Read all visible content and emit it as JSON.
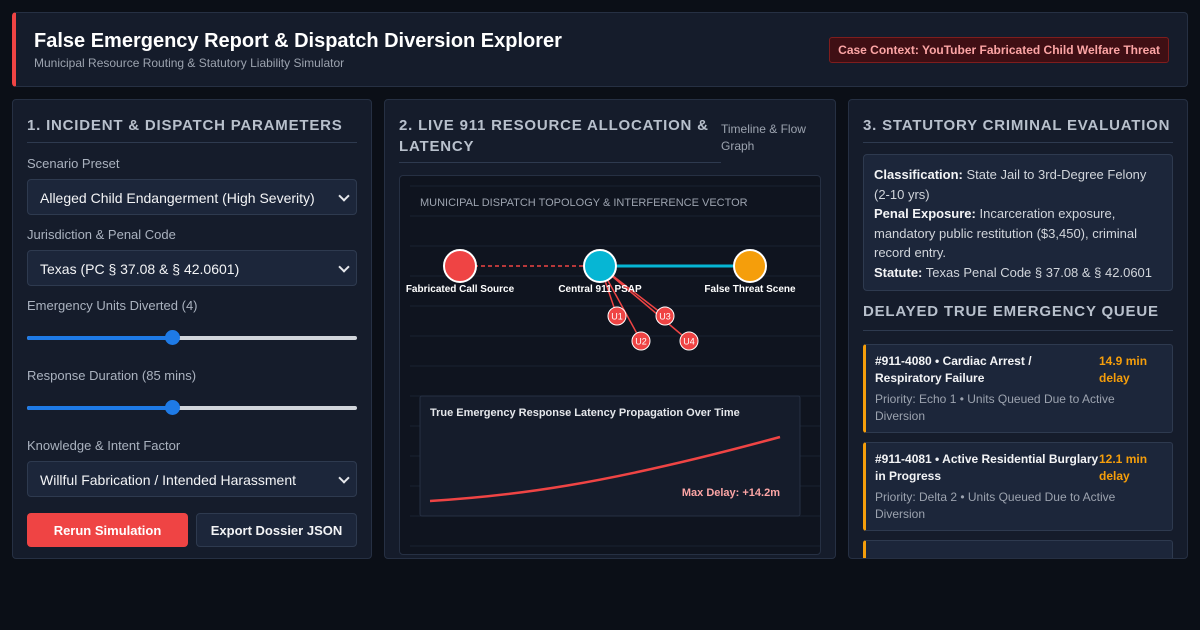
{
  "header": {
    "title": "False Emergency Report & Dispatch Diversion Explorer",
    "subtitle": "Municipal Resource Routing & Statutory Liability Simulator",
    "badge": "Case Context: YouTuber Fabricated Child Welfare Threat"
  },
  "params": {
    "title": "1. INCIDENT & DISPATCH PARAMETERS",
    "scenario_label": "Scenario Preset",
    "scenario_value": "Alleged Child Endangerment (High Severity)",
    "jurisdiction_label": "Jurisdiction & Penal Code",
    "jurisdiction_value": "Texas (PC § 37.08 & § 42.0601)",
    "units_label": "Emergency Units Diverted (4)",
    "units_slider": 0.44,
    "duration_label": "Response Duration (85 mins)",
    "duration_slider": 0.44,
    "intent_label": "Knowledge & Intent Factor",
    "intent_value": "Willful Fabrication / Intended Harassment",
    "rerun_label": "Rerun Simulation",
    "export_label": "Export Dossier JSON"
  },
  "allocation": {
    "title": "2. LIVE 911 RESOURCE ALLOCATION & LATENCY",
    "hint": "Timeline & Flow Graph",
    "topology_label": "MUNICIPAL DISPATCH TOPOLOGY & INTERFERENCE VECTOR",
    "nodes": {
      "source": "Fabricated Call Source",
      "psap": "Central 911 PSAP",
      "scene": "False Threat Scene"
    },
    "units": [
      "U1",
      "U2",
      "U3",
      "U4"
    ],
    "colors": {
      "source": "#ef4444",
      "psap": "#06b6d4",
      "scene": "#f59e0b",
      "unit": "#ef4444"
    },
    "latency_title": "True Emergency Response Latency Propagation Over Time",
    "max_delay": "Max Delay: +14.2m"
  },
  "statutory": {
    "title": "3. STATUTORY CRIMINAL EVALUATION",
    "classification_label": "Classification:",
    "classification_value": "State Jail to 3rd-Degree Felony (2-10 yrs)",
    "penal_label": "Penal Exposure:",
    "penal_value": "Incarceration exposure, mandatory public restitution ($3,450), criminal record entry.",
    "statute_label": "Statute:",
    "statute_value": "Texas Penal Code § 37.08 & § 42.0601"
  },
  "queue": {
    "title": "DELAYED TRUE EMERGENCY QUEUE",
    "items": [
      {
        "name": "#911-4080 • Cardiac Arrest / Respiratory Failure",
        "delay": "14.9 min delay",
        "meta": "Priority: Echo 1 • Units Queued Due to Active Diversion"
      },
      {
        "name": "#911-4081 • Active Residential Burglary in Progress",
        "delay": "12.1 min delay",
        "meta": "Priority: Delta 2 • Units Queued Due to Active Diversion"
      }
    ]
  }
}
